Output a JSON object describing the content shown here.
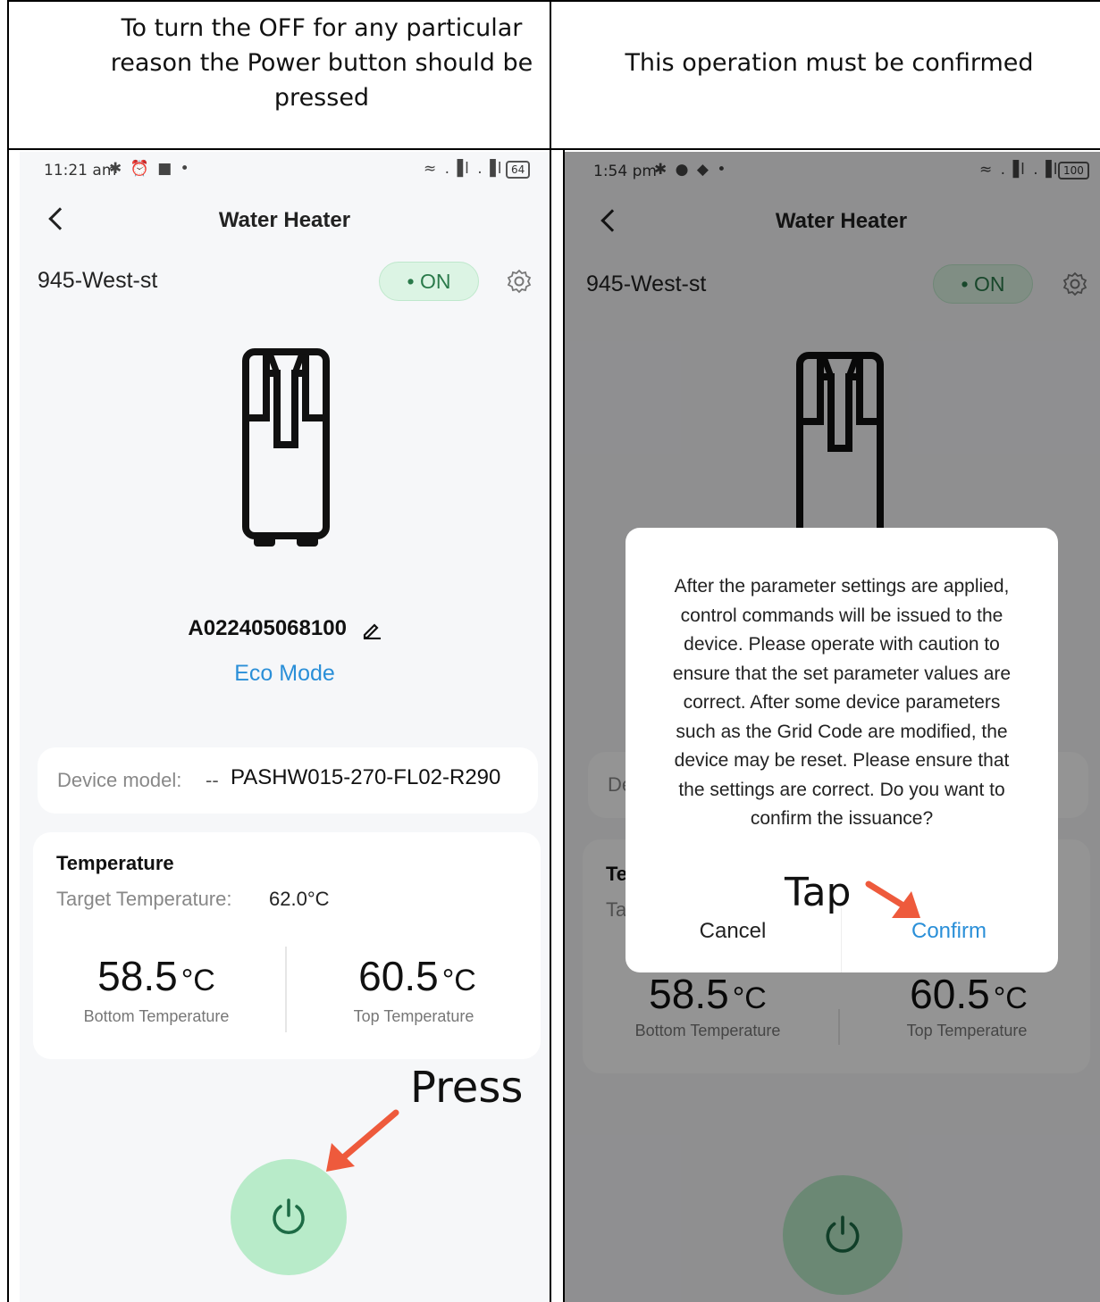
{
  "captions": {
    "left": "To turn the OFF for any particular reason the Power button should be pressed",
    "right": "This operation must be confirmed"
  },
  "left_screen": {
    "status": {
      "time": "11:21 am",
      "icons": "✱ ⏰ ■ •",
      "signal": "≈ .▐l .▐l",
      "battery": "64"
    },
    "header": {
      "title": "Water Heater",
      "back_icon": "chevron-left-icon"
    },
    "device_name": "945-West-st",
    "status_pill": "• ON",
    "serial": "A022405068100",
    "mode": "Eco Mode",
    "device_model": {
      "label": "Device model:",
      "dash": "--",
      "value": "PASHW015-270-FL02-R290"
    },
    "temperature": {
      "title": "Temperature",
      "target_label": "Target Temperature:",
      "target_value": "62.0°C",
      "bottom_value": "58.5",
      "bottom_unit": "°C",
      "bottom_label": "Bottom Temperature",
      "top_value": "60.5",
      "top_unit": "°C",
      "top_label": "Top Temperature"
    },
    "annotation": "Press"
  },
  "right_screen": {
    "status": {
      "time": "1:54 pm",
      "icons": "✱ ● ◆ •",
      "signal": "≈ .▐l .▐l",
      "battery": "100"
    },
    "header": {
      "title": "Water Heater"
    },
    "device_name": "945-West-st",
    "status_pill": "• ON",
    "partial_label_1": "De",
    "partial_label_2": "Te",
    "partial_label_3": "Ta",
    "temperature": {
      "bottom_value": "58.5",
      "bottom_unit": "°C",
      "bottom_label": "Bottom Temperature",
      "top_value": "60.5",
      "top_unit": "°C",
      "top_label": "Top Temperature"
    },
    "dialog": {
      "message": "After the parameter settings are applied, control commands will be issued to the device. Please operate with caution to ensure that the set parameter values are correct. After some device parameters such as the Grid Code are modified, the device may be reset. Please ensure that the settings are correct. Do you want to confirm the issuance?",
      "cancel": "Cancel",
      "confirm": "Confirm"
    },
    "annotation": "Tap"
  },
  "colors": {
    "accent_blue": "#2a8fd8",
    "power_green": "#b8ebc9",
    "arrow_red": "#ee5a3c",
    "pill_green": "#dcf4e4"
  }
}
